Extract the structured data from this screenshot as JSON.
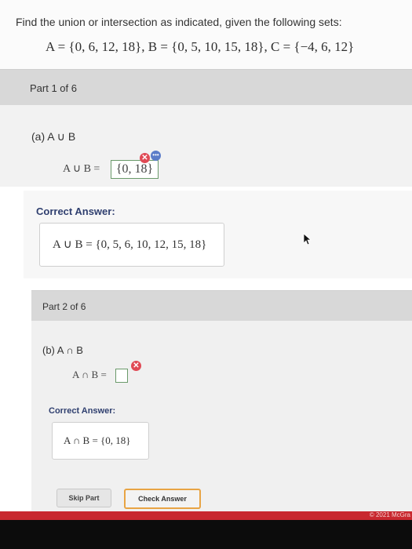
{
  "question": {
    "prompt": "Find the union or intersection as indicated, given the following sets:",
    "sets": "A = {0, 6, 12, 18},  B = {0, 5, 10, 15, 18},  C = {−4, 6, 12}"
  },
  "part1": {
    "header": "Part 1 of 6",
    "label": "(a) A ∪ B",
    "answer_prefix": "A ∪ B =",
    "answer_value": "{0, 18}",
    "correct_title": "Correct Answer:",
    "correct_text": "A ∪ B = {0, 5, 6, 10, 12, 15, 18}"
  },
  "part2": {
    "header": "Part 2 of 6",
    "label": "(b) A ∩ B",
    "answer_prefix": "A ∩ B =",
    "correct_title": "Correct Answer:",
    "correct_text": "A ∩ B = {0, 18}"
  },
  "buttons": {
    "skip": "Skip Part",
    "check": "Check Answer"
  },
  "footer": {
    "copyright": "© 2021 McGra"
  },
  "icons": {
    "incorrect": "x-badge-icon",
    "more": "more-options-icon",
    "cursor": "mouse-cursor-icon"
  },
  "colors": {
    "error_badge": "#e04a55",
    "info_badge": "#5b7cc9",
    "check_border": "#e8a444",
    "footer_bar": "#c8282f"
  }
}
